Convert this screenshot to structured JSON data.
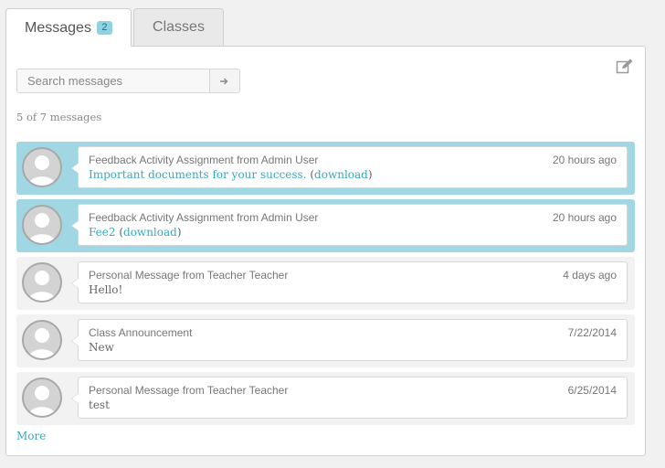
{
  "tabs": {
    "messages_label": "Messages",
    "messages_badge": "2",
    "classes_label": "Classes"
  },
  "search": {
    "placeholder": "Search messages",
    "value": ""
  },
  "count_text": "5 of 7 messages",
  "messages": [
    {
      "subject": "Feedback Activity Assignment from Admin User",
      "time": "20 hours ago",
      "text": "Important documents for your success.",
      "open": " (",
      "download": "download",
      "close": ")",
      "unread": true
    },
    {
      "subject": "Feedback Activity Assignment from Admin User",
      "time": "20 hours ago",
      "text": "Fee2",
      "open": " (",
      "download": "download",
      "close": ")",
      "unread": true
    },
    {
      "subject": "Personal Message from Teacher Teacher",
      "time": "4 days ago",
      "text": "Hello!",
      "unread": false
    },
    {
      "subject": "Class Announcement",
      "time": "7/22/2014",
      "text": "New",
      "unread": false
    },
    {
      "subject": "Personal Message from Teacher Teacher",
      "time": "6/25/2014",
      "text": "test",
      "unread": false
    }
  ],
  "more_label": "More",
  "colors": {
    "unread_bg": "#a1d7e2",
    "read_bg": "#f2f2f2",
    "link": "#36a9c3",
    "badge_bg": "#8fd3e0"
  }
}
